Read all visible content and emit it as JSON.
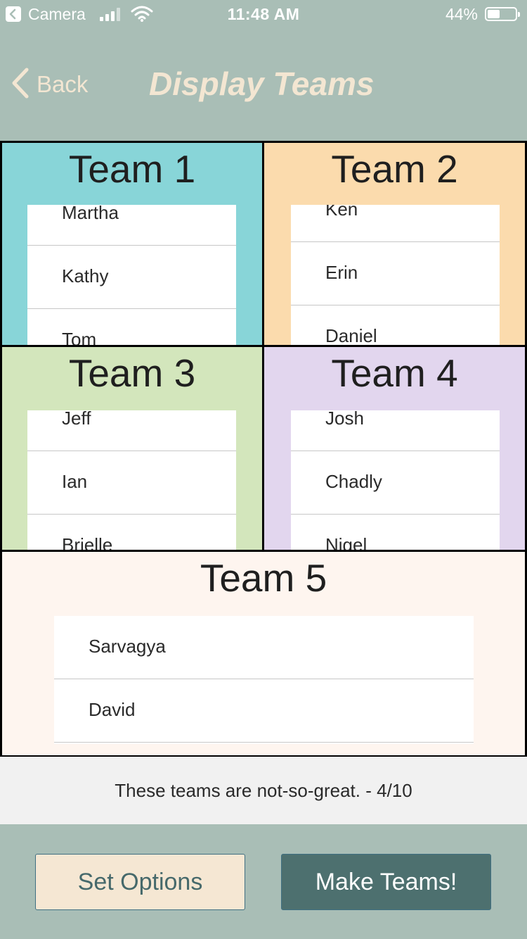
{
  "status_bar": {
    "app": "Camera",
    "time": "11:48 AM",
    "battery": "44%",
    "battery_level": 0.44
  },
  "nav": {
    "back_label": "Back",
    "title": "Display Teams"
  },
  "teams": [
    {
      "title": "Team 1",
      "color": "#88d5d8",
      "members": [
        "Martha",
        "Kathy",
        "Tom"
      ]
    },
    {
      "title": "Team 2",
      "color": "#fbdbad",
      "members": [
        "Ken",
        "Erin",
        "Daniel"
      ]
    },
    {
      "title": "Team 3",
      "color": "#d3e6bc",
      "members": [
        "Jeff",
        "Ian",
        "Brielle"
      ]
    },
    {
      "title": "Team 4",
      "color": "#e2d6ee",
      "members": [
        "Josh",
        "Chadly",
        "Nigel"
      ]
    },
    {
      "title": "Team 5",
      "color": "#fef5ef",
      "members": [
        "Sarvagya",
        "David"
      ]
    }
  ],
  "rating_text": "These teams are not-so-great. - 4/10",
  "buttons": {
    "set_options": "Set Options",
    "make_teams": "Make Teams!"
  },
  "colors": {
    "background": "#a9beb6",
    "nav_text": "#f3e6d2",
    "primary_button": "#4d706f",
    "secondary_button": "#f5e7d3"
  }
}
